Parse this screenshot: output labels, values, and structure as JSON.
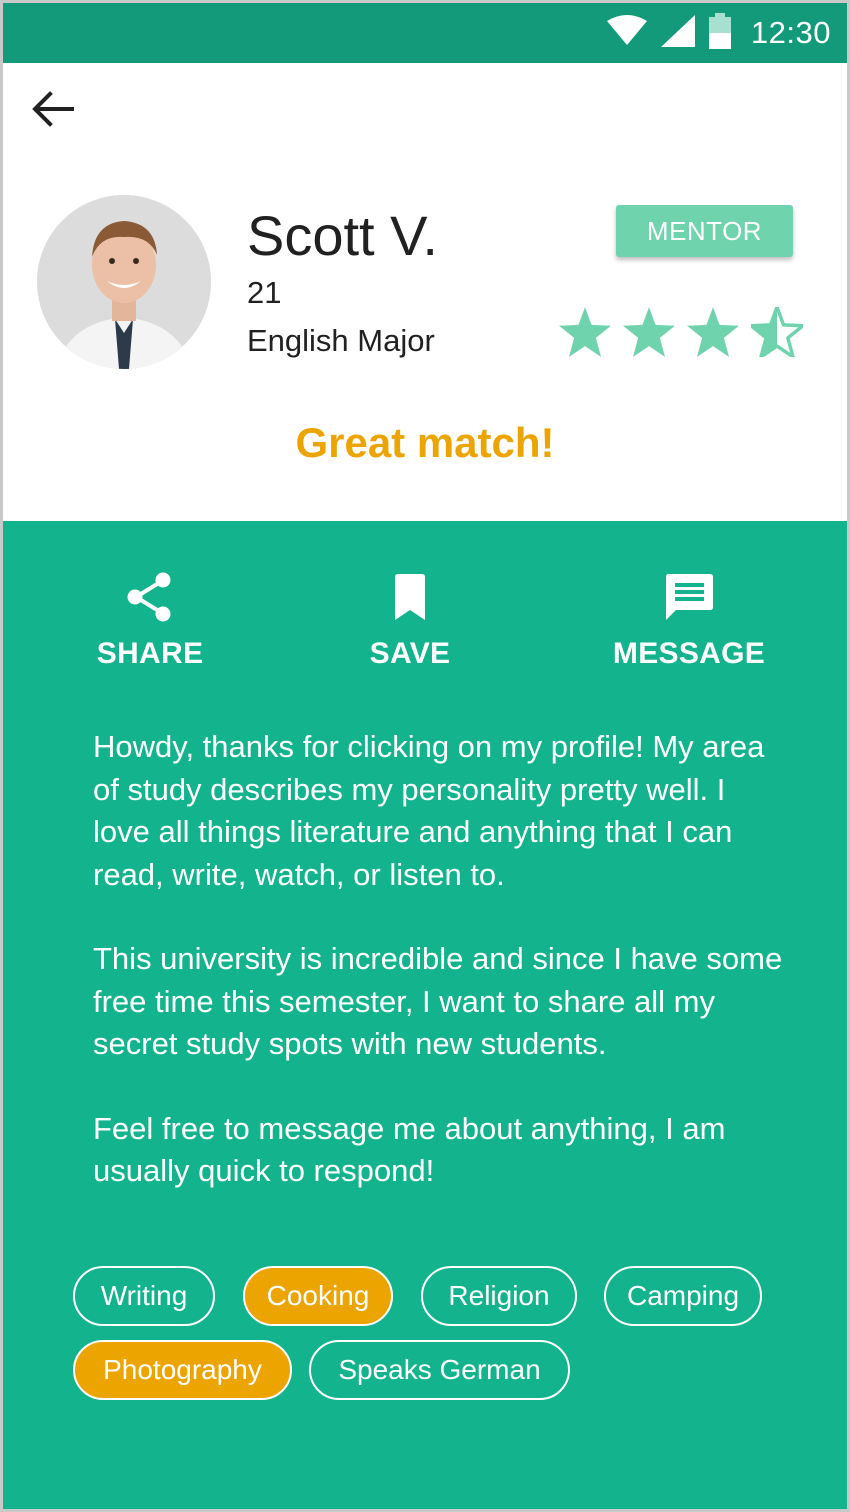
{
  "status_bar": {
    "time": "12:30",
    "icons": [
      "wifi-icon",
      "cell-signal-icon",
      "battery-icon"
    ],
    "color": "#139a7a"
  },
  "header": {
    "back_icon": "arrow-left-icon"
  },
  "profile": {
    "name": "Scott V.",
    "age": "21",
    "major": "English Major",
    "badge": "MENTOR",
    "rating": 3.5,
    "rating_max": 4,
    "match_text": "Great match!"
  },
  "actions": [
    {
      "label": "SHARE",
      "icon": "share-icon"
    },
    {
      "label": "SAVE",
      "icon": "bookmark-icon"
    },
    {
      "label": "MESSAGE",
      "icon": "message-icon"
    }
  ],
  "bio": {
    "paragraphs": [
      "Howdy, thanks for clicking on my profile! My area of study describes my personality pretty well. I love all things literature and anything that I can read, write, watch, or listen to.",
      "This university is incredible and since I have some free time this semester, I want to share all my secret study spots with new students.",
      "Feel free to message me about anything, I am usually quick to respond!"
    ]
  },
  "tags": [
    {
      "label": "Writing",
      "active": false
    },
    {
      "label": "Cooking",
      "active": true
    },
    {
      "label": "Religion",
      "active": false
    },
    {
      "label": "Camping",
      "active": false
    },
    {
      "label": "Photography",
      "active": true
    },
    {
      "label": "Speaks German",
      "active": false
    }
  ],
  "colors": {
    "primary_dark": "#139a7a",
    "primary": "#13b38e",
    "badge": "#6fd3ad",
    "accent": "#eca400",
    "star": "#6fd3ad"
  }
}
